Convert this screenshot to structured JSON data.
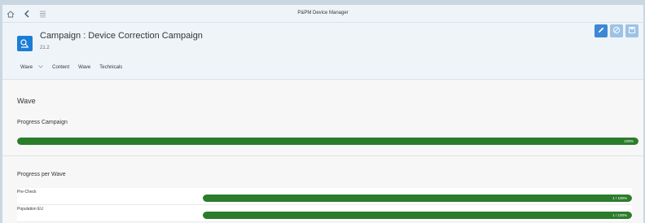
{
  "shell": {
    "title": "P&PM Device Manager"
  },
  "header": {
    "title": "Campaign : Device Correction Campaign",
    "subtitle": "21.2",
    "tabs": [
      {
        "label": "Wave",
        "has_dropdown": true
      },
      {
        "label": "Content",
        "has_dropdown": false
      },
      {
        "label": "Wave",
        "has_dropdown": false
      },
      {
        "label": "Technicals",
        "has_dropdown": false
      }
    ]
  },
  "content": {
    "section_title": "Wave",
    "progress_campaign": {
      "title": "Progress Campaign",
      "value_label": "100%",
      "percent": 100
    },
    "progress_per_wave": {
      "title": "Progress per Wave",
      "rows": [
        {
          "label": "Pre-Check",
          "value_label": "1 / 100%",
          "percent": 100
        },
        {
          "label": "Population EU",
          "value_label": "1 / 100%",
          "percent": 100
        }
      ]
    }
  },
  "colors": {
    "progress_fill": "#2b7c2b",
    "accent": "#1a7ed6",
    "shell_background": "#eff4f9"
  },
  "icons": [
    "home-icon",
    "back-icon",
    "menu-icon",
    "campaign-icon",
    "edit-icon",
    "cancel-icon",
    "save-icon"
  ]
}
